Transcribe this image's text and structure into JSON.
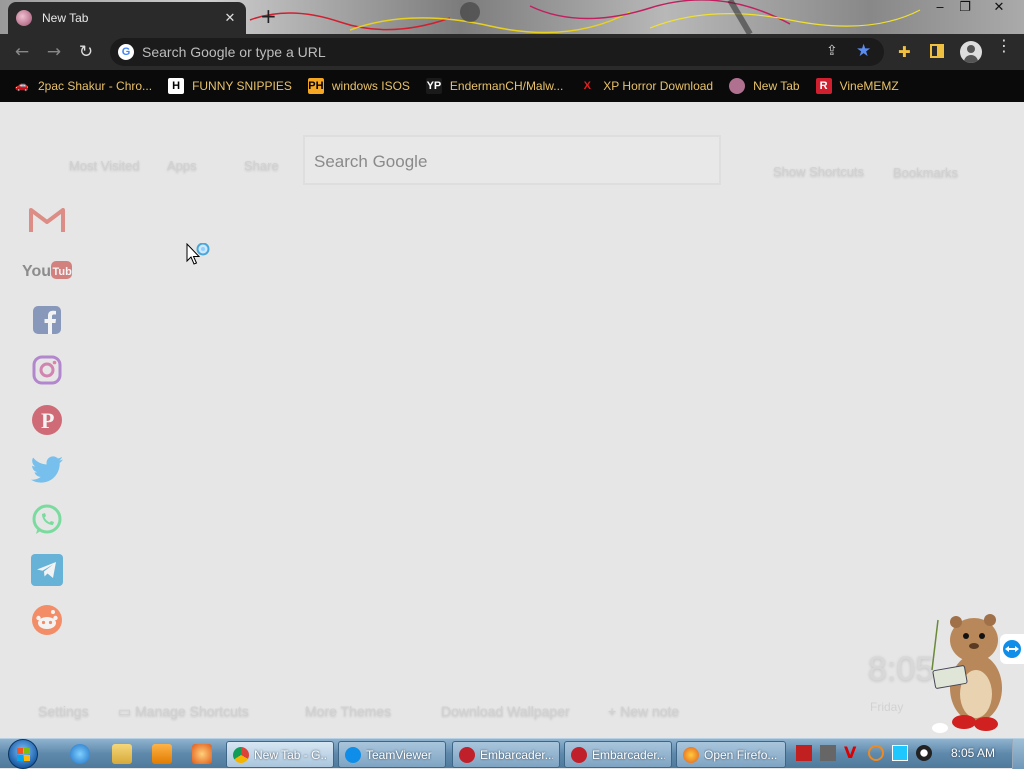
{
  "browser": {
    "tab": {
      "title": "New Tab",
      "close": "✕"
    },
    "new_tab": "+",
    "window_controls": {
      "minimize": "‒",
      "restore": "❐",
      "close": "✕"
    },
    "nav": {
      "back": "←",
      "forward": "→",
      "reload": "↻"
    },
    "omnibox": {
      "placeholder": "Search Google or type a URL",
      "g_glyph": "G"
    },
    "menu_glyph": "⋮"
  },
  "bookmarks": [
    {
      "label": "2pac Shakur - Chro...",
      "icon": "car-icon",
      "icon_text": "🚗",
      "icon_bg": "#0a0a0a",
      "icon_color": "#d06030"
    },
    {
      "label": "FUNNY SNIPPIES",
      "icon": "h-logo-icon",
      "icon_text": "H",
      "icon_bg": "#ffffff",
      "icon_color": "#000000"
    },
    {
      "label": "windows ISOS",
      "icon": "ph-logo-icon",
      "icon_text": "PH",
      "icon_bg": "#f5a623",
      "icon_color": "#000000"
    },
    {
      "label": "EndermanCH/Malw...",
      "icon": "yp-logo-icon",
      "icon_text": "YP",
      "icon_bg": "#1a1a1a",
      "icon_color": "#ffffff"
    },
    {
      "label": "XP Horror Download",
      "icon": "x-logo-icon",
      "icon_text": "X",
      "icon_bg": "#0a0a0a",
      "icon_color": "#e02020"
    },
    {
      "label": "New Tab",
      "icon": "newtab-favicon-icon",
      "icon_text": "",
      "icon_bg": "#b07090",
      "icon_color": "#ffffff"
    },
    {
      "label": "VineMEMZ",
      "icon": "r-logo-icon",
      "icon_text": "R",
      "icon_bg": "#d02030",
      "icon_color": "#ffffff"
    }
  ],
  "newtab": {
    "top_links": {
      "most_visited": "Most Visited",
      "apps": "Apps",
      "share": "Share",
      "show_shortcuts": "Show Shortcuts",
      "bookmarks": "Bookmarks"
    },
    "search_placeholder": "Search Google",
    "bottom_links": {
      "settings": "Settings",
      "manage_shortcuts": "Manage Shortcuts",
      "more_themes": "More Themes",
      "download_wallpaper": "Download Wallpaper",
      "new_note": "New note"
    },
    "clock": {
      "time": "8:05",
      "day": "Friday"
    },
    "social": [
      {
        "name": "gmail-icon",
        "color": "#d44638"
      },
      {
        "name": "youtube-icon",
        "color": "#c4302b"
      },
      {
        "name": "facebook-icon",
        "color": "#3b5998"
      },
      {
        "name": "instagram-icon",
        "color": "#8a3ab9"
      },
      {
        "name": "pinterest-icon",
        "color": "#bd081c"
      },
      {
        "name": "twitter-icon",
        "color": "#1da1f2"
      },
      {
        "name": "whatsapp-icon",
        "color": "#25d366"
      },
      {
        "name": "telegram-icon",
        "color": "#0088cc"
      },
      {
        "name": "reddit-icon",
        "color": "#ff4500"
      }
    ]
  },
  "taskbar": {
    "buttons": [
      {
        "label": "New Tab - G...",
        "icon": "chrome-icon",
        "active": true
      },
      {
        "label": "TeamViewer",
        "icon": "teamviewer-icon",
        "active": false
      },
      {
        "label": "Embarcader...",
        "icon": "embarcadero-icon",
        "active": false
      },
      {
        "label": "Embarcader...",
        "icon": "embarcadero-icon",
        "active": false
      },
      {
        "label": "Open Firefo...",
        "icon": "firefox-icon",
        "active": false
      }
    ],
    "time": "8:05 AM"
  }
}
